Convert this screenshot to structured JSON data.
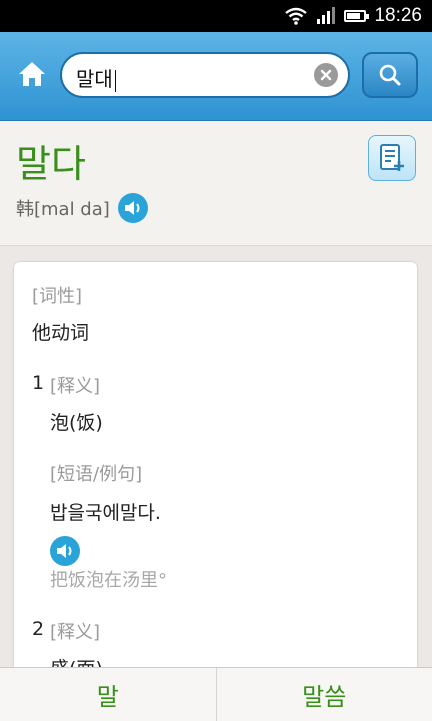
{
  "status_bar": {
    "time": "18:26",
    "battery_level": 0.8
  },
  "search": {
    "query": "말대"
  },
  "entry": {
    "headword": "말다",
    "pronunciation": "韩[mal da]",
    "pos_label": "[词性]",
    "pos": "他动词",
    "senses": [
      {
        "number": "1",
        "def_label": "[释义]",
        "definition": "泡(饭)",
        "phrase_label": "[短语/例句]",
        "example": "밥을국에말다.",
        "example_translation": "把饭泡在汤里°"
      },
      {
        "number": "2",
        "def_label": "[释义]",
        "definition": "盛(面)"
      }
    ]
  },
  "tabs": [
    "말",
    "말씀"
  ],
  "colors": {
    "accent_green": "#3a8f1c",
    "header_blue": "#2f93d2",
    "speaker_blue": "#2aa3d8"
  }
}
